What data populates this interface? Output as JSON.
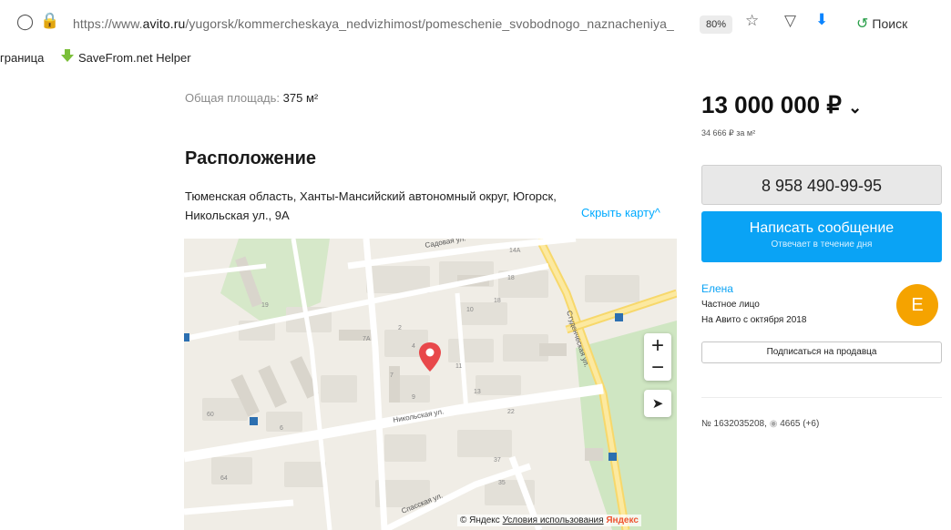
{
  "browser": {
    "url_prefix": "https://www.",
    "url_domain": "avito.ru",
    "url_path": "/yugorsk/kommercheskaya_nedvizhimost/pomeschenie_svobodnogo_naznacheniya_",
    "zoom": "80%",
    "search_label": "Поиск"
  },
  "bookmarks": {
    "items": [
      "граница",
      "SaveFrom.net Helper"
    ]
  },
  "listing": {
    "area_label": "Общая площадь:",
    "area_value": "375 м²",
    "location_title": "Расположение",
    "address_line1": "Тюменская область, Ханты-Мансийский автономный округ, Югорск,",
    "address_line2": "Никольская ул., 9А",
    "hide_map": "Скрыть карту^"
  },
  "map": {
    "streets": [
      "Садовая ул.",
      "Студенческая ул.",
      "Никольская ул.",
      "Спасская ул."
    ],
    "footer_brand": "© Яндекс",
    "footer_terms": "Условия использования",
    "footer_logo": "Яндекс",
    "zoom_in": "+",
    "zoom_out": "−"
  },
  "sidebar": {
    "price": "13 000 000 ₽",
    "price_per_m": "34 666 ₽ за м²",
    "phone": "8 958 490-99-95",
    "message_title": "Написать сообщение",
    "message_sub": "Отвечает в течение дня",
    "seller_name": "Елена",
    "seller_type": "Частное лицо",
    "seller_since": "На Авито с октября 2018",
    "avatar_letter": "Е",
    "subscribe": "Подписаться на продавца",
    "ad_number": "№ 1632035208,",
    "views": "4665 (+6)"
  },
  "colors": {
    "accent": "#0aa3f5",
    "avatar": "#f5a300",
    "pin": "#e8484b"
  }
}
